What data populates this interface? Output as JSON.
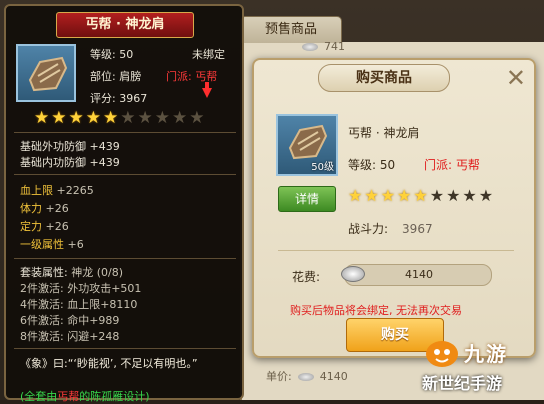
{
  "background": {
    "tab_label": "预售商品",
    "price_top": "741",
    "price_bottom_label": "单价:",
    "price_bottom": "4140"
  },
  "tooltip": {
    "title": "丐帮 · 神龙肩",
    "level_label": "等级:",
    "level_value": "50",
    "bind_status": "未绑定",
    "slot_label": "部位:",
    "slot_value": "肩膀",
    "sect_label": "门派:",
    "sect_value": "丐帮",
    "score_label": "评分:",
    "score_value": "3967",
    "stars_filled": 5,
    "stars_total": 10,
    "base_stats": [
      {
        "label": "基础外功防御",
        "value": "+439"
      },
      {
        "label": "基础内功防御",
        "value": "+439"
      }
    ],
    "extra_stats": [
      {
        "label": "血上限",
        "value": "+2265"
      },
      {
        "label": "体力",
        "value": "+26"
      },
      {
        "label": "定力",
        "value": "+26"
      },
      {
        "label": "一级属性",
        "value": "+6"
      }
    ],
    "set_header_label": "套装属性:",
    "set_header_value": "神龙 (0/8)",
    "set_bonuses": [
      {
        "label": "2件激活:",
        "stat": "外功攻击",
        "value": "+501"
      },
      {
        "label": "4件激活:",
        "stat": "血上限",
        "value": "+8110"
      },
      {
        "label": "6件激活:",
        "stat": "命中",
        "value": "+989"
      },
      {
        "label": "8件激活:",
        "stat": "闪避",
        "value": "+248"
      }
    ],
    "description": "《象》曰:“‘眇能视’, 不足以有明也。”",
    "footer_prefix": "(全套由",
    "footer_sect": "丐帮",
    "footer_suffix": "的陈孤雁设计)"
  },
  "dialog": {
    "title": "购买商品",
    "item_name": "丐帮 · 神龙肩",
    "level_label": "等级:",
    "level_value": "50",
    "sect_label": "门派:",
    "sect_value": "丐帮",
    "icon_badge": "50级",
    "detail_button": "详情",
    "stars_filled": 5,
    "stars_total": 9,
    "power_label": "战斗力:",
    "power_value": "3967",
    "cost_label": "花费:",
    "cost_value": "4140",
    "warning": "购买后物品将会绑定, 无法再次交易",
    "buy_button": "购买"
  },
  "watermark": {
    "brand": "九游",
    "site": "新世纪手游"
  },
  "colors": {
    "star_on": "#ffd23a",
    "sect_red": "#ff3a3a",
    "stat_yellow": "#f0c23a",
    "set_green": "#37d64b"
  }
}
